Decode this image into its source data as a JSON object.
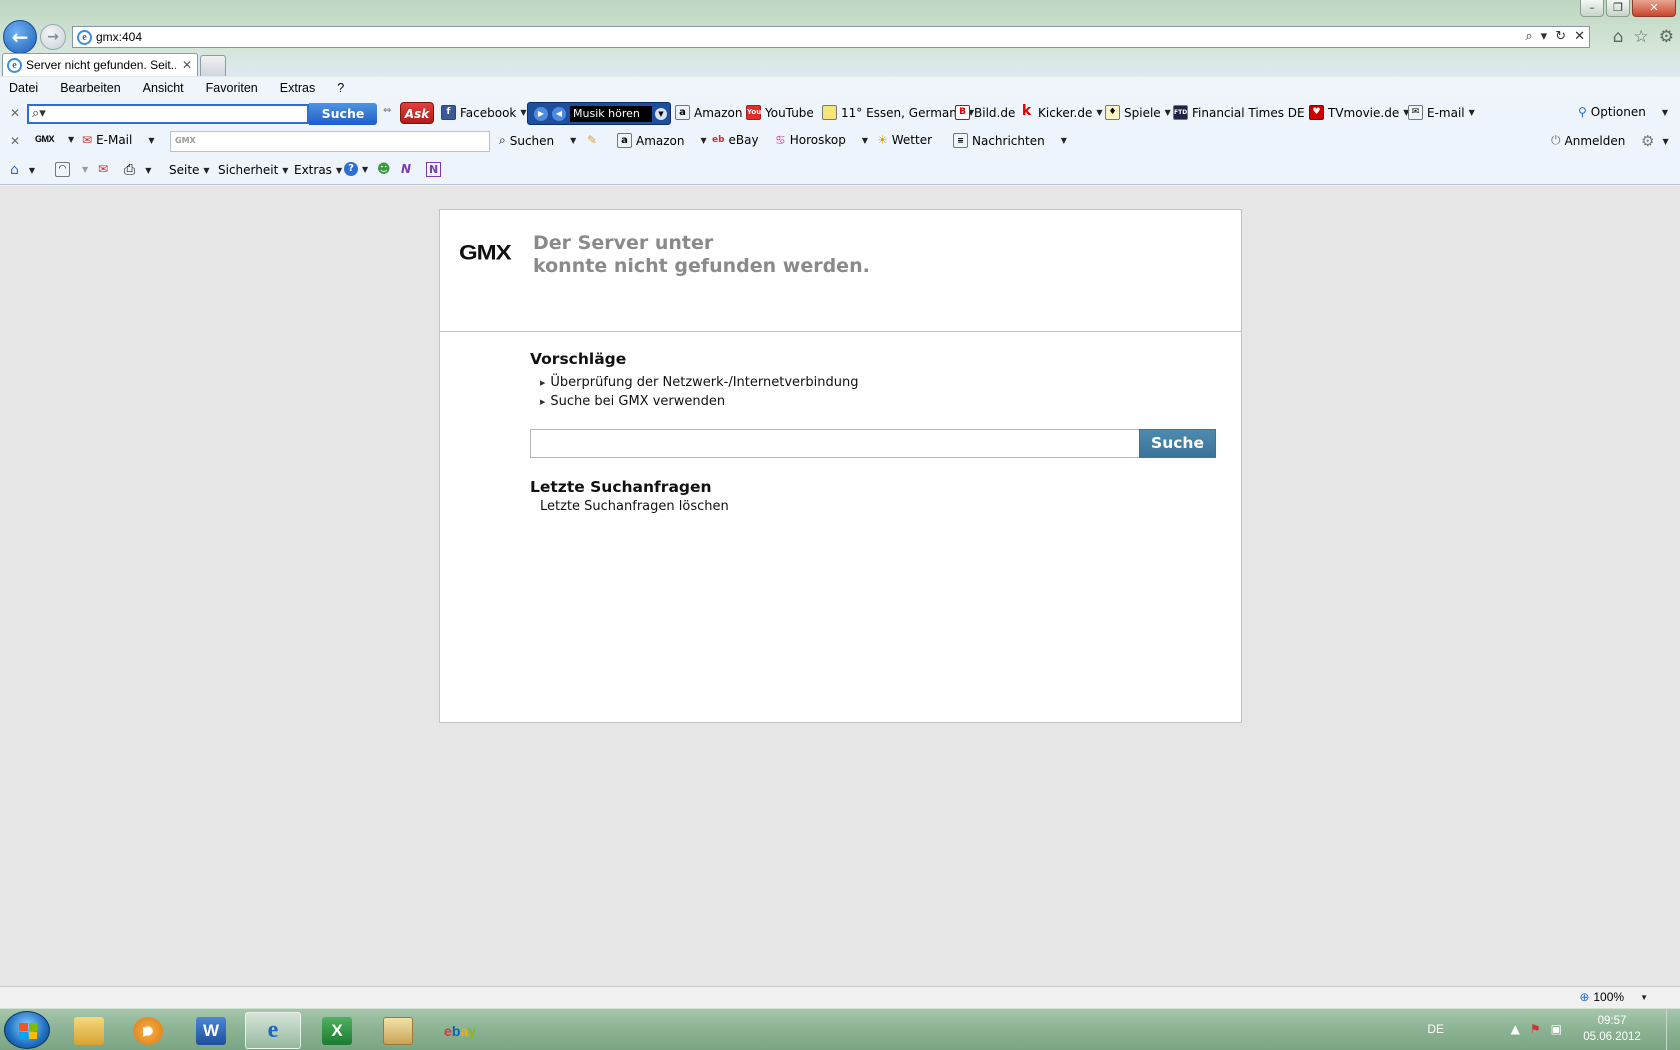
{
  "window": {
    "address_url": "gmx:404",
    "tab_title": "Server nicht gefunden. Seit...",
    "tab_close": "✕"
  },
  "menubar": [
    "Datei",
    "Bearbeiten",
    "Ansicht",
    "Favoriten",
    "Extras",
    "?"
  ],
  "ask_toolbar": {
    "search_button": "Suche",
    "logo": "Ask",
    "links": {
      "facebook": "Facebook",
      "music": "Musik hören",
      "amazon": "Amazon",
      "youtube": "YouTube",
      "weather": "11° Essen, Germany",
      "bild": "Bild.de",
      "kicker": "Kicker.de",
      "spiele": "Spiele",
      "ftd": "Financial Times DE",
      "tvmovie": "TVmovie.de",
      "email": "E-mail"
    },
    "options": "Optionen"
  },
  "gmx_toolbar": {
    "logo": "GMX",
    "email": "E-Mail",
    "search_placeholder": "GMX",
    "suchen": "Suchen",
    "amazon": "Amazon",
    "ebay": "eBay",
    "horoskop": "Horoskop",
    "wetter": "Wetter",
    "nachrichten": "Nachrichten",
    "anmelden": "Anmelden"
  },
  "command_bar": {
    "seite": "Seite",
    "sicherheit": "Sicherheit",
    "extras": "Extras"
  },
  "page": {
    "logo": "GMX",
    "error_line1": "Der Server unter",
    "error_line2": "konnte nicht gefunden werden.",
    "suggestions_heading": "Vorschläge",
    "suggestions": [
      "Überprüfung der Netzwerk-/Internetverbindung",
      "Suche bei GMX verwenden"
    ],
    "search_button": "Suche",
    "recent_heading": "Letzte Suchanfragen",
    "recent_clear": "Letzte Suchanfragen löschen"
  },
  "status_bar": {
    "zoom": "100%"
  },
  "taskbar": {
    "language": "DE",
    "time": "09:57",
    "date": "05.06.2012",
    "apps": [
      "explorer",
      "media-player",
      "word",
      "internet-explorer",
      "excel",
      "photo-viewer",
      "ebay"
    ]
  },
  "colors": {
    "ask_blue": "#1d5fc4",
    "gmx_button": "#3a739a",
    "error_grey": "#8a8a8a",
    "page_bg": "#e6e6e6"
  }
}
